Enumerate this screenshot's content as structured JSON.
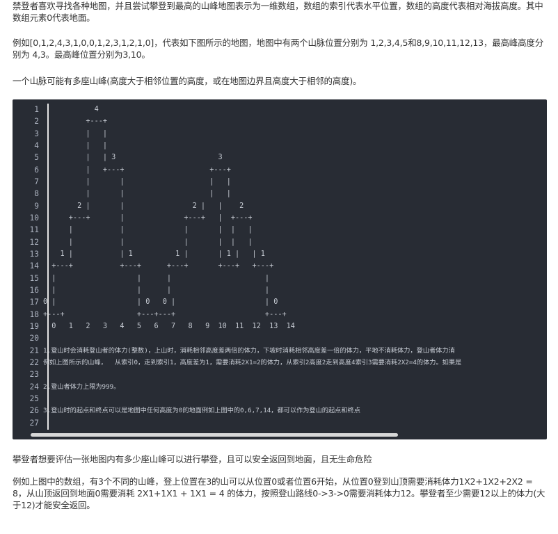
{
  "intro": {
    "p1": "禁登者喜欢寻找各种地图，并且尝试攀登到最高的山峰地图表示为一维数组，数组的索引代表水平位置，数组的高度代表相对海拔高度。其中数组元素0代表地面。",
    "p2": "例如[0,1,2,4,3,1,0,0,1,2,3,1,2,1,0]，代表如下图所示的地图，地图中有两个山脉位置分别为 1,2,3,4,5和8,9,10,11,12,13，最高峰高度分别为 4,3。最高峰位置分别为3,10。",
    "p3": "一个山脉可能有多座山峰(高度大于相邻位置的高度，或在地图边界且高度大于相邻的高度)。"
  },
  "code": {
    "line_numbers": [
      "1",
      "2",
      "3",
      "4",
      "5",
      "6",
      "7",
      "8",
      "9",
      "10",
      "11",
      "12",
      "13",
      "14",
      "15",
      "16",
      "17",
      "18",
      "19",
      "20",
      "21",
      "22",
      "23",
      "24",
      "25",
      "26",
      "27"
    ],
    "lines": [
      "            4",
      "          +---+",
      "          |   |",
      "          |   |",
      "          |   | 3                        3",
      "          |   +---+                    +---+",
      "          |       |                    |   |",
      "          |       |                    |   |",
      "        2 |       |                2 |   |    2",
      "      +---+       |              +---+   |  +---+",
      "      |           |              |       |  |   |",
      "      |           |              |       |  |   |",
      "    1 |           | 1          1 |       | 1 |   | 1",
      "  +---+           +---+      +---+       +---+   +---+",
      "  |                   |      |                      |",
      "  |                   |      |                      |",
      "0 |                   | 0   0 |                     | 0",
      "+---+                 +---+---+                     +---+",
      "  0   1   2   3   4   5   6   7   8   9  10  11  12  13  14",
      "",
      "1.登山时会消耗登山者的体力(整数)，上山时，消耗相邻高度差两倍的体力，下坡时消耗相邻高度差一倍的体力，平地不消耗体力，登山者体力消",
      "例如上图所示的山峰，  从索引0，走到索引1，高度差为1，需要消耗2X1=2的体力，从索引2高度2走到高度4索引3需要消耗2X2=4的体力。如果是",
      "",
      "2.登山者体力上限为999。",
      "",
      "3.登山时的起点和终点可以是地图中任何高度为0的地面例如上图中的0,6,7,14，都可以作为登山的起点和终点",
      ""
    ]
  },
  "outro": {
    "p4": "攀登者想要评估一张地图内有多少座山峰可以进行攀登，且可以安全返回到地面，且无生命危险",
    "p5": "例如上图中的数组，有3个不同的山峰，登上位置在3的山可以从位置0或者位置6开始，从位置0登到山顶需要消耗体力1X2+1X2+2X2 = 8，从山顶返回到地面0需要消耗 2X1+1X1 + 1X1 = 4 的体力，按照登山路线0->3->0需要消耗体力12。攀登者至少需要12以上的体力(大于12)才能安全返回。"
  },
  "colors": {
    "code_bg": "#282c34",
    "code_fg": "#c7ccd4",
    "text": "#333333"
  }
}
